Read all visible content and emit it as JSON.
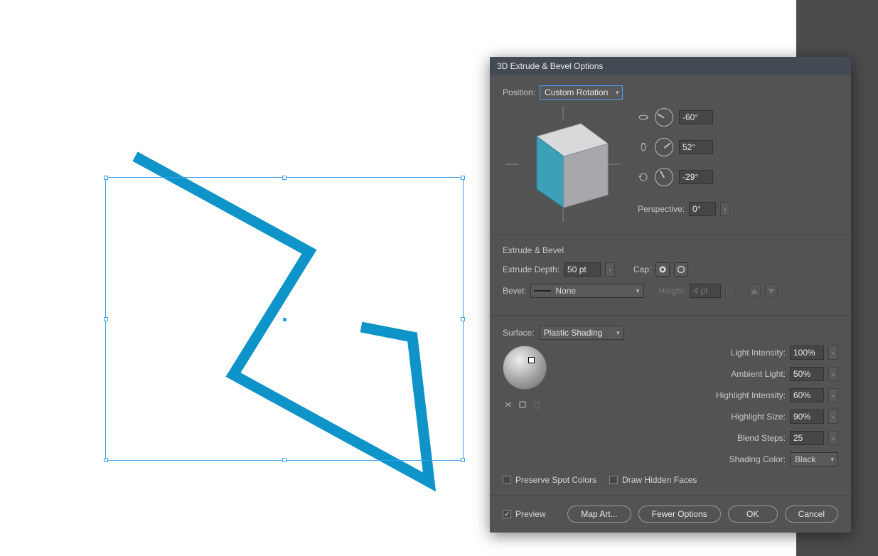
{
  "dialog": {
    "title": "3D Extrude & Bevel Options",
    "position_label": "Position:",
    "position_value": "Custom Rotation",
    "rotation": {
      "x": "-60°",
      "y": "52°",
      "z": "-29°"
    },
    "perspective_label": "Perspective:",
    "perspective_value": "0°"
  },
  "extrude": {
    "section_title": "Extrude & Bevel",
    "depth_label": "Extrude Depth:",
    "depth_value": "50 pt",
    "cap_label": "Cap:",
    "bevel_label": "Bevel:",
    "bevel_value": "None",
    "height_label": "Height:",
    "height_value": "4 pt"
  },
  "surface": {
    "label": "Surface:",
    "value": "Plastic Shading",
    "light_intensity_label": "Light Intensity:",
    "light_intensity_value": "100%",
    "ambient_label": "Ambient Light:",
    "ambient_value": "50%",
    "hi_intensity_label": "Highlight Intensity:",
    "hi_intensity_value": "60%",
    "hi_size_label": "Highlight Size:",
    "hi_size_value": "90%",
    "blend_label": "Blend Steps:",
    "blend_value": "25",
    "shading_color_label": "Shading Color:",
    "shading_color_value": "Black",
    "preserve_spot_label": "Preserve Spot Colors",
    "draw_hidden_label": "Draw Hidden Faces"
  },
  "footer": {
    "preview_label": "Preview",
    "map_art": "Map Art...",
    "fewer_options": "Fewer Options",
    "ok": "OK",
    "cancel": "Cancel"
  },
  "colors": {
    "accent": "#0f94c9",
    "panel": "#535353"
  }
}
